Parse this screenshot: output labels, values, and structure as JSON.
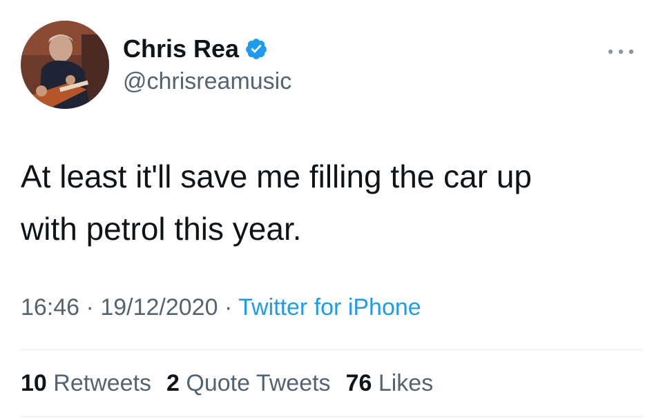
{
  "tweet": {
    "author": {
      "display_name": "Chris Rea",
      "handle": "@chrisreamusic",
      "verified_icon": "verified-badge-icon"
    },
    "menu_icon": "more-options-icon",
    "text_lines": [
      "At least it'll save me filling the car up",
      "with petrol this year."
    ],
    "time": "16:46",
    "separator": "·",
    "date": "19/12/2020",
    "source": "Twitter for iPhone",
    "stats": {
      "retweets_count": "10",
      "retweets_label": "Retweets",
      "quotes_count": "2",
      "quotes_label": "Quote Tweets",
      "likes_count": "76",
      "likes_label": "Likes"
    }
  },
  "colors": {
    "text_primary": "#0f1419",
    "text_secondary": "#536471",
    "accent": "#1d9bf0",
    "divider": "#e6ecf0"
  }
}
